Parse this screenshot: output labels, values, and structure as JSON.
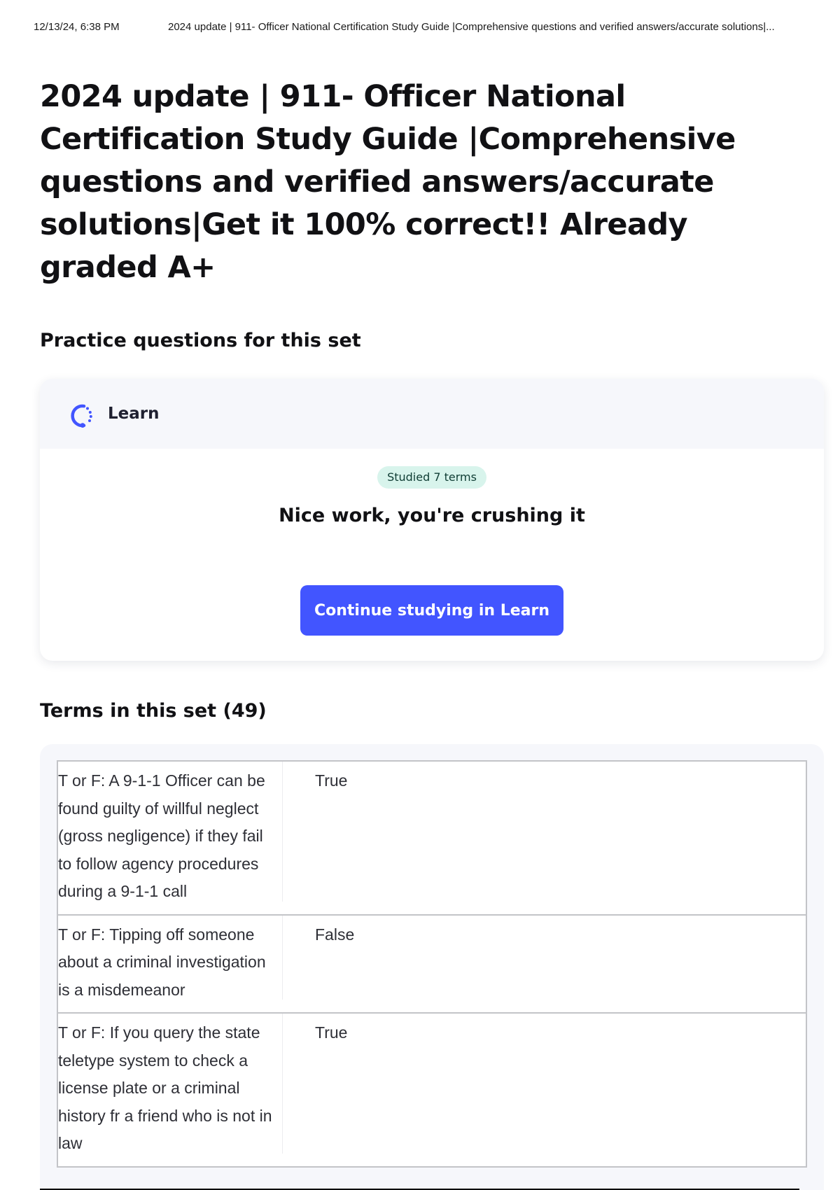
{
  "print_header": {
    "date": "12/13/24, 6:38 PM",
    "title": "2024 update | 911- Officer National Certification Study Guide |Comprehensive questions and verified answers/accurate solutions|..."
  },
  "page": {
    "title": "2024 update | 911- Officer National Certification Study Guide |Comprehensive questions and verified answers/accurate solutions|Get it 100% correct!! Already graded A+"
  },
  "practice": {
    "heading": "Practice questions for this set",
    "learn_label": "Learn",
    "badge": "Studied 7 terms",
    "message": "Nice work, you're crushing it",
    "button_label": "Continue studying in Learn",
    "colors": {
      "accent": "#4255ff",
      "badge_bg": "#d8f4ec",
      "card_header_bg": "#f6f7fb"
    },
    "icons": {
      "learn": "learn-progress-icon"
    }
  },
  "terms": {
    "heading": "Terms in this set (49)",
    "items": [
      {
        "term": "T or F: A 9-1-1 Officer can be found guilty of willful neglect (gross negligence) if they fail to follow agency procedures during a 9-1-1 call",
        "definition": "True"
      },
      {
        "term": "T or F: Tipping off someone about a criminal investigation is a misdemeanor",
        "definition": "False"
      },
      {
        "term": "T or F: If you query the state teletype system to check a license plate or a criminal history fr a friend who is not in law",
        "definition": "True"
      }
    ]
  }
}
